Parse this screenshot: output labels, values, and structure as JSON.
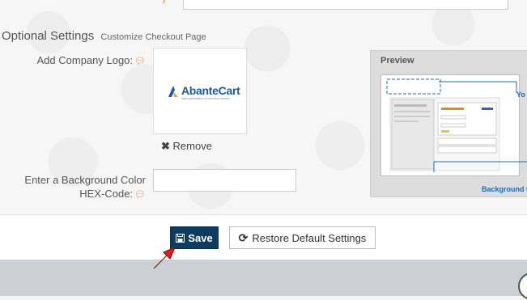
{
  "section": {
    "title": "Optional Settings",
    "subtitle": "Customize Checkout Page"
  },
  "logo_field": {
    "label": "Add Company Logo:",
    "logo_text": "AbanteCart",
    "logo_tagline": "ideal optimization eCommerce solution",
    "remove_label": "Remove"
  },
  "bg_color_field": {
    "label_line1": "Enter a Background Color",
    "label_line2": "HEX-Code:",
    "value": ""
  },
  "preview": {
    "title": "Preview",
    "callout_top": "Yo",
    "callout_bottom": "Background C"
  },
  "actions": {
    "save_label": "Save",
    "restore_label": "Restore Default Settings"
  },
  "colors": {
    "accent": "#e8861e",
    "save_bg": "#0d3c5e",
    "link_blue": "#1a6bb8",
    "pointer_red": "#e02020"
  }
}
